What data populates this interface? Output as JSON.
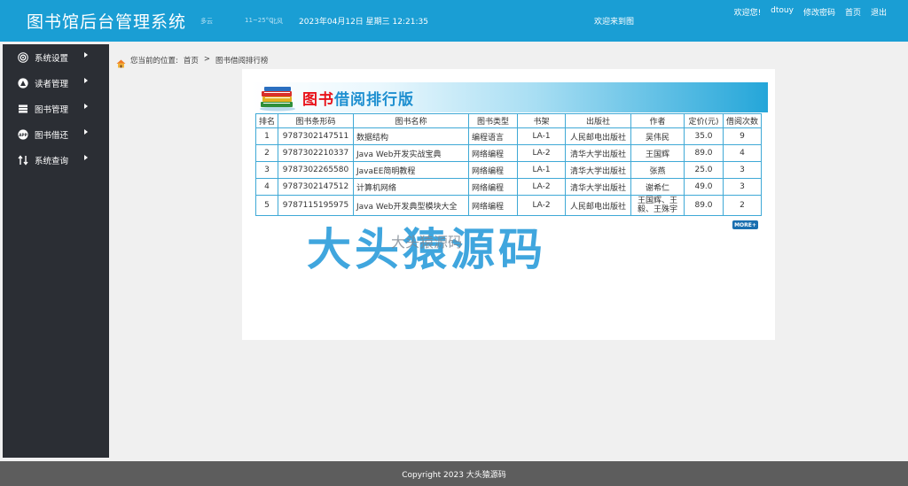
{
  "header": {
    "title": "图书馆后台管理系统",
    "weather_1": "多云",
    "weather_2": "11~25°C",
    "weather_3": "北风",
    "datetime": "2023年04月12日 星期三 12:21:35",
    "welcome_center": "欢迎来到图",
    "links": {
      "welcome": "欢迎您!",
      "user": "dtouy",
      "change_pwd": "修改密码",
      "home": "首页",
      "logout": "退出"
    }
  },
  "sidebar": {
    "items": [
      {
        "label": "系统设置",
        "icon": "settings-icon"
      },
      {
        "label": "读者管理",
        "icon": "reader-icon"
      },
      {
        "label": "图书管理",
        "icon": "books-icon"
      },
      {
        "label": "图书借还",
        "icon": "app-icon"
      },
      {
        "label": "系统查询",
        "icon": "query-icon"
      }
    ]
  },
  "breadcrumb": {
    "prefix": "您当前的位置:",
    "home": "首页",
    "sep": ">",
    "current": "图书借阅排行榜"
  },
  "banner": {
    "title_red": "图书",
    "title_blue": "借阅排行版"
  },
  "table": {
    "headers": [
      "排名",
      "图书条形码",
      "图书名称",
      "图书类型",
      "书架",
      "出版社",
      "作者",
      "定价(元)",
      "借阅次数"
    ],
    "rows": [
      [
        "1",
        "9787302147511",
        "数据结构",
        "编程语言",
        "LA-1",
        "人民邮电出版社",
        "吴伟民",
        "35.0",
        "9"
      ],
      [
        "2",
        "9787302210337",
        "Java Web开发实战宝典",
        "网络编程",
        "LA-2",
        "清华大学出版社",
        "王国辉",
        "89.0",
        "4"
      ],
      [
        "3",
        "9787302265580",
        "JavaEE简明教程",
        "网络编程",
        "LA-1",
        "清华大学出版社",
        "张燕",
        "25.0",
        "3"
      ],
      [
        "4",
        "9787302147512",
        "计算机网络",
        "网络编程",
        "LA-2",
        "清华大学出版社",
        "谢希仁",
        "49.0",
        "3"
      ],
      [
        "5",
        "9787115195975",
        "Java Web开发典型模块大全",
        "网络编程",
        "LA-2",
        "人民邮电出版社",
        "王国辉、王毅、王殊宇",
        "89.0",
        "2"
      ]
    ]
  },
  "more_button": "MORE+",
  "watermark": {
    "large": "大头猿源码",
    "small": "大头猿源码"
  },
  "footer": "Copyright 2023 大头猿源码",
  "colors": {
    "header": "#1a9ed4",
    "sidebar": "#2b2e34",
    "table_border": "#3fa9d6",
    "footer": "#5d5d5d"
  }
}
